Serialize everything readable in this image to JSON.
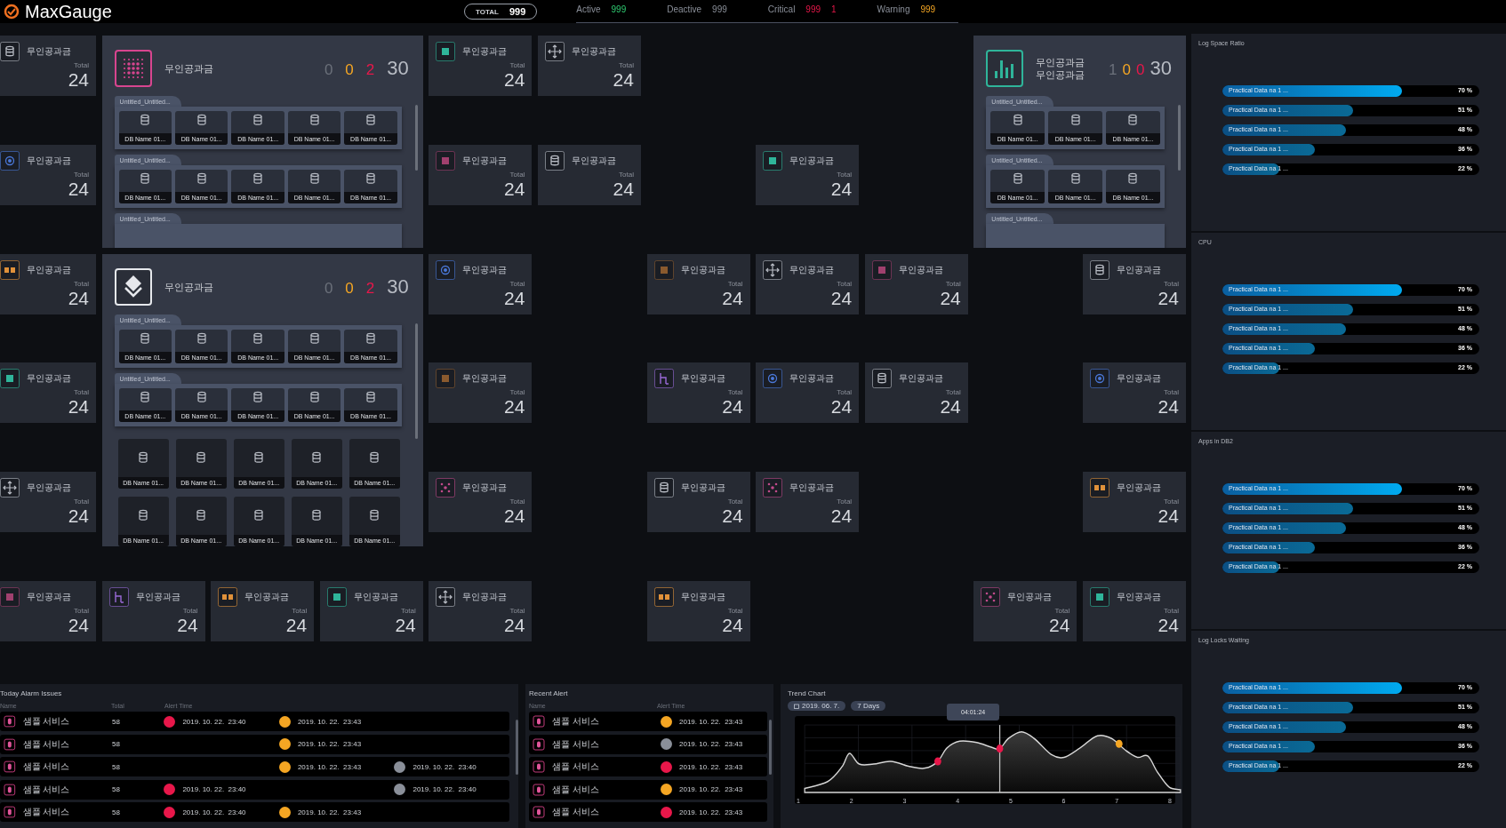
{
  "header": {
    "logo": "MaxGauge",
    "total": {
      "label": "TOTAL",
      "value": "999"
    },
    "statuses": [
      {
        "label": "Active",
        "values": [
          "999"
        ]
      },
      {
        "label": "Deactive",
        "values": [
          "999"
        ]
      },
      {
        "label": "Critical",
        "values": [
          "999",
          "1"
        ]
      },
      {
        "label": "Warning",
        "values": [
          "999"
        ]
      }
    ]
  },
  "tiles": [
    {
      "kind": "tile",
      "label": "무인공과금",
      "total_label": "Total",
      "value": "24"
    },
    {
      "kind": "card",
      "title": [
        "무인공과금"
      ],
      "counts": [
        "0",
        "0",
        "2",
        "30"
      ],
      "groups": [
        {
          "label": "Untitled_Untitled...",
          "items": [
            "DB Name 01...",
            "DB Name 01...",
            "DB Name 01...",
            "DB Name 01...",
            "DB Name 01..."
          ]
        },
        {
          "label": "Untitled_Untitled...",
          "items": [
            "DB Name 01...",
            "DB Name 01...",
            "DB Name 01...",
            "DB Name 01...",
            "DB Name 01..."
          ]
        },
        {
          "label": "Untitled_Untitled..."
        }
      ]
    },
    {
      "kind": "tile",
      "label": "무인공과금",
      "total_label": "Total",
      "value": "24"
    },
    {
      "kind": "tile",
      "label": "무인공과금",
      "total_label": "Total",
      "value": "24"
    },
    {
      "kind": "card",
      "title": [
        "무인공과금",
        "무인공과금"
      ],
      "counts": [
        "1",
        "0",
        "0",
        "30"
      ],
      "groups": [
        {
          "label": "Untitled_Untitled...",
          "items": [
            "DB Name 01...",
            "DB Name 01...",
            "DB Name 01..."
          ]
        },
        {
          "label": "Untitled_Untitled...",
          "items": [
            "DB Name 01...",
            "DB Name 01...",
            "DB Name 01..."
          ]
        },
        {
          "label": "Untitled_Untitled..."
        }
      ]
    },
    {
      "kind": "tile",
      "label": "무인공과금",
      "total_label": "Total",
      "value": "24"
    },
    {
      "kind": "tile",
      "label": "무인공과금",
      "total_label": "Total",
      "value": "24"
    },
    {
      "kind": "tile",
      "label": "무인공과금",
      "total_label": "Total",
      "value": "24"
    },
    {
      "kind": "tile",
      "label": "무인공과금",
      "total_label": "Total",
      "value": "24"
    },
    {
      "kind": "tile",
      "label": "무인공과금",
      "total_label": "Total",
      "value": "24"
    },
    {
      "kind": "card",
      "title": [
        "무인공과금"
      ],
      "counts": [
        "0",
        "0",
        "2",
        "30"
      ],
      "groups": [
        {
          "label": "Untitled_Untitled...",
          "items": [
            "DB Name 01...",
            "DB Name 01...",
            "DB Name 01...",
            "DB Name 01...",
            "DB Name 01..."
          ]
        },
        {
          "label": "Untitled_Untitled...",
          "items": [
            "DB Name 01...",
            "DB Name 01...",
            "DB Name 01...",
            "DB Name 01...",
            "DB Name 01..."
          ]
        }
      ],
      "loose_items": [
        "DB Name 01...",
        "DB Name 01...",
        "DB Name 01...",
        "DB Name 01...",
        "DB Name 01...",
        "DB Name 01...",
        "DB Name 01...",
        "DB Name 01...",
        "DB Name 01...",
        "DB Name 01..."
      ]
    },
    {
      "kind": "tile",
      "label": "무인공과금",
      "total_label": "Total",
      "value": "24"
    },
    {
      "kind": "tile",
      "label": "무인공과금",
      "total_label": "Total",
      "value": "24"
    },
    {
      "kind": "tile",
      "label": "무인공과금",
      "total_label": "Total",
      "value": "24"
    },
    {
      "kind": "tile",
      "label": "무인공과금",
      "total_label": "Total",
      "value": "24"
    },
    {
      "kind": "tile",
      "label": "무인공과금",
      "total_label": "Total",
      "value": "24"
    },
    {
      "kind": "tile",
      "label": "무인공과금",
      "total_label": "Total",
      "value": "24"
    },
    {
      "kind": "tile",
      "label": "무인공과금",
      "total_label": "Total",
      "value": "24"
    },
    {
      "kind": "tile",
      "label": "무인공과금",
      "total_label": "Total",
      "value": "24"
    },
    {
      "kind": "tile",
      "label": "무인공과금",
      "total_label": "Total",
      "value": "24"
    },
    {
      "kind": "tile",
      "label": "무인공과금",
      "total_label": "Total",
      "value": "24"
    },
    {
      "kind": "tile",
      "label": "무인공과금",
      "total_label": "Total",
      "value": "24"
    },
    {
      "kind": "tile",
      "label": "무인공과금",
      "total_label": "Total",
      "value": "24"
    },
    {
      "kind": "tile",
      "label": "무인공과금",
      "total_label": "Total",
      "value": "24"
    },
    {
      "kind": "tile",
      "label": "무인공과금",
      "total_label": "Total",
      "value": "24"
    },
    {
      "kind": "tile",
      "label": "무인공과금",
      "total_label": "Total",
      "value": "24"
    },
    {
      "kind": "tile",
      "label": "무인공과금",
      "total_label": "Total",
      "value": "24"
    },
    {
      "kind": "tile",
      "label": "무인공과금",
      "total_label": "Total",
      "value": "24"
    },
    {
      "kind": "tile",
      "label": "무인공과금",
      "total_label": "Total",
      "value": "24"
    },
    {
      "kind": "tile",
      "label": "무인공과금",
      "total_label": "Total",
      "value": "24"
    },
    {
      "kind": "tile",
      "label": "무인공과금",
      "total_label": "Total",
      "value": "24"
    },
    {
      "kind": "tile",
      "label": "무인공과금",
      "total_label": "Total",
      "value": "24"
    },
    {
      "kind": "tile",
      "label": "무인공과금",
      "total_label": "Total",
      "value": "24"
    },
    {
      "kind": "tile",
      "label": "무인공과금",
      "total_label": "Total",
      "value": "24"
    },
    {
      "kind": "tile",
      "label": "무인공과금",
      "total_label": "Total",
      "value": "24"
    }
  ],
  "today_alarms": {
    "title": "Today Alarm Issues",
    "columns": [
      "Name",
      "Total",
      "Alert Time"
    ],
    "rows": [
      {
        "name": "샘플 서비스",
        "total": "58",
        "alerts": [
          {
            "kind": "critical",
            "color": "#e8174a",
            "time": "2019. 10. 22.  23:40"
          },
          {
            "kind": "warning",
            "color": "#f5a623",
            "time": "2019. 10. 22.  23:43"
          }
        ]
      },
      {
        "name": "샘플 서비스",
        "total": "58",
        "alerts": [
          {
            "kind": "warning",
            "color": "#f5a623",
            "time": "2019. 10. 22.  23:43"
          }
        ]
      },
      {
        "name": "샘플 서비스",
        "total": "58",
        "alerts": [
          {
            "kind": "warning",
            "color": "#f5a623",
            "time": "2019. 10. 22.  23:43"
          },
          {
            "kind": "info",
            "color": "#8a8f99",
            "time": "2019. 10. 22.  23:40"
          }
        ]
      },
      {
        "name": "샘플 서비스",
        "total": "58",
        "alerts": [
          {
            "kind": "critical",
            "color": "#e8174a",
            "time": "2019. 10. 22.  23:40"
          },
          {
            "kind": "info",
            "color": "#8a8f99",
            "time": "2019. 10. 22.  23:40"
          }
        ]
      },
      {
        "name": "샘플 서비스",
        "total": "58",
        "alerts": [
          {
            "kind": "critical",
            "color": "#e8174a",
            "time": "2019. 10. 22.  23:40"
          },
          {
            "kind": "warning",
            "color": "#f5a623",
            "time": "2019. 10. 22.  23:43"
          }
        ]
      }
    ]
  },
  "recent_alerts": {
    "title": "Recent Alert",
    "columns": [
      "Name",
      "Alert Time"
    ],
    "rows": [
      {
        "name": "샘플 서비스",
        "color": "#f5a623",
        "time": "2019. 10. 22.  23:43"
      },
      {
        "name": "샘플 서비스",
        "color": "#8a8f99",
        "time": "2019. 10. 22.  23:43"
      },
      {
        "name": "샘플 서비스",
        "color": "#e8174a",
        "time": "2019. 10. 22.  23:43"
      },
      {
        "name": "샘플 서비스",
        "color": "#f5a623",
        "time": "2019. 10. 22.  23:43"
      },
      {
        "name": "샘플 서비스",
        "color": "#e8174a",
        "time": "2019. 10. 22.  23:43"
      }
    ]
  },
  "trend": {
    "title": "Trend Chart",
    "date": "2019. 06. 7.",
    "range": "7 Days",
    "tooltip": "04:01:24",
    "x_labels": [
      "1",
      "2",
      "3",
      "4",
      "5",
      "6",
      "7",
      "8"
    ]
  },
  "side_panels": [
    {
      "title": "Log Space Ratio",
      "bars": [
        {
          "label": "Practical Data na 1 ...",
          "level": 0.7,
          "reading": "70 %"
        },
        {
          "label": "Practical Data na 1 ...",
          "level": 0.51,
          "reading": "51 %"
        },
        {
          "label": "Practical Data na 1 ...",
          "level": 0.48,
          "reading": "48 %"
        },
        {
          "label": "Practical Data na 1 ...",
          "level": 0.36,
          "reading": "36 %"
        },
        {
          "label": "Practical Data na 1 ...",
          "level": 0.22,
          "reading": "22 %"
        }
      ]
    },
    {
      "title": "CPU",
      "bars": [
        {
          "label": "Practical Data na 1 ...",
          "level": 0.7,
          "reading": "70 %"
        },
        {
          "label": "Practical Data na 1 ...",
          "level": 0.51,
          "reading": "51 %"
        },
        {
          "label": "Practical Data na 1 ...",
          "level": 0.48,
          "reading": "48 %"
        },
        {
          "label": "Practical Data na 1 ...",
          "level": 0.36,
          "reading": "36 %"
        },
        {
          "label": "Practical Data na 1 ...",
          "level": 0.22,
          "reading": "22 %"
        }
      ]
    },
    {
      "title": "Apps in DB2",
      "bars": [
        {
          "label": "Practical Data na 1 ...",
          "level": 0.7,
          "reading": "70 %"
        },
        {
          "label": "Practical Data na 1 ...",
          "level": 0.51,
          "reading": "51 %"
        },
        {
          "label": "Practical Data na 1 ...",
          "level": 0.48,
          "reading": "48 %"
        },
        {
          "label": "Practical Data na 1 ...",
          "level": 0.36,
          "reading": "36 %"
        },
        {
          "label": "Practical Data na 1 ...",
          "level": 0.22,
          "reading": "22 %"
        }
      ]
    },
    {
      "title": "Log Locks Waiting",
      "bars": [
        {
          "label": "Practical Data na 1 ...",
          "level": 0.7,
          "reading": "70 %"
        },
        {
          "label": "Practical Data na 1 ...",
          "level": 0.51,
          "reading": "51 %"
        },
        {
          "label": "Practical Data na 1 ...",
          "level": 0.48,
          "reading": "48 %"
        },
        {
          "label": "Practical Data na 1 ...",
          "level": 0.36,
          "reading": "36 %"
        },
        {
          "label": "Practical Data na 1 ...",
          "level": 0.22,
          "reading": "22 %"
        }
      ]
    }
  ]
}
